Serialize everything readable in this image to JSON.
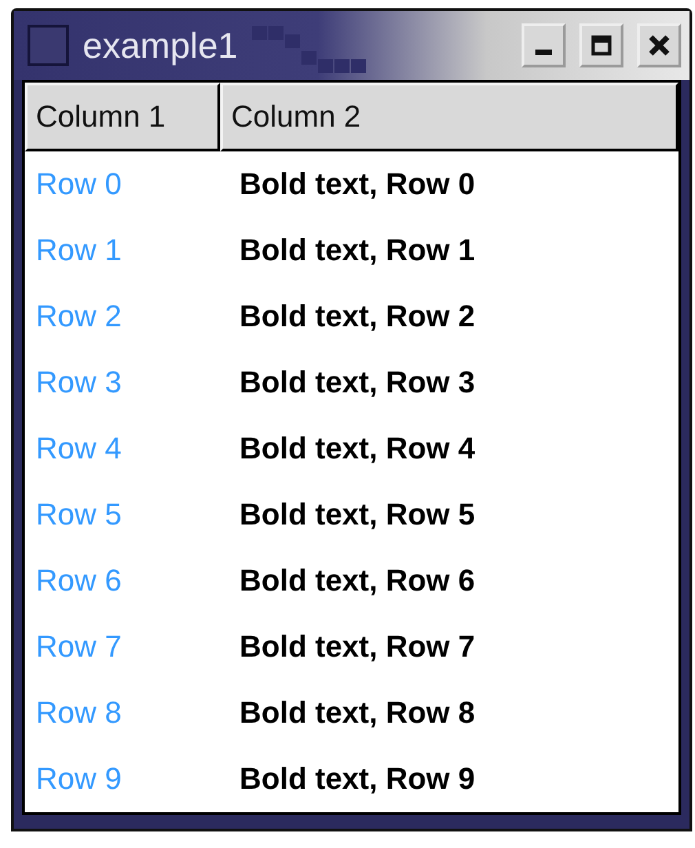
{
  "window": {
    "title": "example1"
  },
  "table": {
    "columns": [
      "Column 1",
      "Column 2"
    ],
    "rows": [
      {
        "cells": [
          "Row 0",
          "Bold text, Row 0"
        ]
      },
      {
        "cells": [
          "Row 1",
          "Bold text, Row 1"
        ]
      },
      {
        "cells": [
          "Row 2",
          "Bold text, Row 2"
        ]
      },
      {
        "cells": [
          "Row 3",
          "Bold text, Row 3"
        ]
      },
      {
        "cells": [
          "Row 4",
          "Bold text, Row 4"
        ]
      },
      {
        "cells": [
          "Row 5",
          "Bold text, Row 5"
        ]
      },
      {
        "cells": [
          "Row 6",
          "Bold text, Row 6"
        ]
      },
      {
        "cells": [
          "Row 7",
          "Bold text, Row 7"
        ]
      },
      {
        "cells": [
          "Row 8",
          "Bold text, Row 8"
        ]
      },
      {
        "cells": [
          "Row 9",
          "Bold text, Row 9"
        ]
      }
    ]
  }
}
